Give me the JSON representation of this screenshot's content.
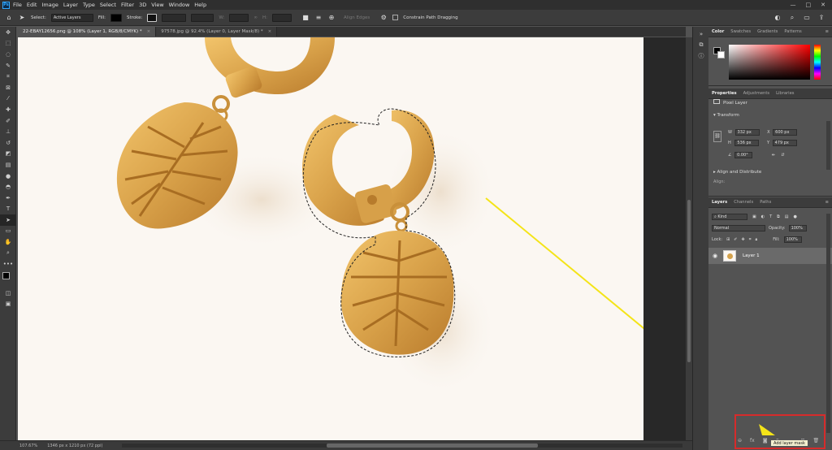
{
  "menu": {
    "logo": "Ps",
    "items": [
      "File",
      "Edit",
      "Image",
      "Layer",
      "Type",
      "Select",
      "Filter",
      "3D",
      "View",
      "Window",
      "Help"
    ],
    "window_controls": [
      "—",
      "□",
      "✕"
    ]
  },
  "options": {
    "select_label": "Select:",
    "select_value": "Active Layers",
    "fill_label": "Fill:",
    "stroke_label": "Stroke:",
    "w_label": "W:",
    "h_label": "H:",
    "align_edges": "Align Edges",
    "constrain": "Constrain Path Dragging"
  },
  "tabs": [
    {
      "label": "22-EBAY12656.png @ 108% (Layer 1, RGB/8/CMYK) *",
      "close": "×"
    },
    {
      "label": "97578.jpg @ 92.4% (Layer 0, Layer Mask/8) *",
      "close": "×"
    }
  ],
  "tools": [
    "move-tool",
    "marquee-tool",
    "lasso-tool",
    "quick-select-tool",
    "crop-tool",
    "frame-tool",
    "eyedropper-tool",
    "spot-heal-tool",
    "brush-tool",
    "stamp-tool",
    "history-brush-tool",
    "eraser-tool",
    "gradient-tool",
    "blur-tool",
    "dodge-tool",
    "pen-tool",
    "type-tool",
    "path-select-tool",
    "rectangle-tool",
    "hand-tool",
    "zoom-tool",
    "more-tool"
  ],
  "status": {
    "zoom": "107.67%",
    "doc_info": "1346 px x 1210 px (72 ppi)"
  },
  "color_panel": {
    "tabs": [
      "Color",
      "Swatches",
      "Gradients",
      "Patterns"
    ]
  },
  "properties_panel": {
    "tabs": [
      "Properties",
      "Adjustments",
      "Libraries"
    ],
    "layer_type": "Pixel Layer",
    "transform_label": "Transform",
    "w_label": "W",
    "w_value": "332 px",
    "x_label": "X",
    "x_value": "600 px",
    "h_label": "H",
    "h_value": "536 px",
    "y_label": "Y",
    "y_value": "479 px",
    "angle_value": "0.00°",
    "align_label": "Align and Distribute",
    "align_sub": "Align:"
  },
  "layers_panel": {
    "tabs": [
      "Layers",
      "Channels",
      "Paths"
    ],
    "kind_label": "Kind",
    "blend_mode": "Normal",
    "opacity_label": "Opacity:",
    "opacity_value": "100%",
    "lock_label": "Lock:",
    "fill_label": "Fill:",
    "fill_value": "100%",
    "layer_name": "Layer 1",
    "bottom_icons": [
      "link-icon",
      "fx-icon",
      "mask-icon",
      "adjustment-icon",
      "folder-icon",
      "new-layer-icon",
      "trash-icon"
    ]
  },
  "tooltip": "Add layer mask",
  "colors": {
    "accent": "#31a8ff",
    "highlight_box": "#d62b2b",
    "arrow": "#f4e418",
    "gold": "#d4a24c"
  }
}
